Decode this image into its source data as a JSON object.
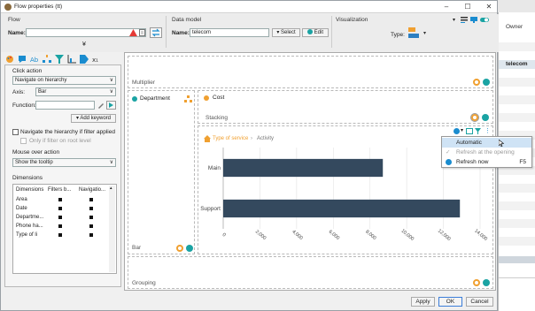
{
  "window": {
    "title": "Flow properties (tt)",
    "minimize": "–",
    "maximize": "☐",
    "close": "✕"
  },
  "background": {
    "owner_label": "Owner",
    "selected_row": "telecom"
  },
  "flow": {
    "section": "Flow",
    "name_label": "Name:",
    "name_value": ""
  },
  "data_model": {
    "section": "Data model",
    "name_label": "Name:",
    "name_value": "telecom",
    "select_label": "Select",
    "edit_label": "Edit"
  },
  "visualization": {
    "section": "Visualization",
    "type_label": "Type:"
  },
  "left_panel": {
    "click_action_label": "Click action",
    "click_action_value": "Navigate on hierarchy",
    "axis_label": "Axis:",
    "axis_value": "Bar",
    "function_label": "Function:",
    "function_value": "",
    "add_keyword_label": "Add keyword",
    "navigate_check_label": "Navigate the hierarchy if filter applied",
    "only_filter_label": "Only if filter on root level",
    "mouseover_label": "Mouse over action",
    "mouseover_value": "Show the tooltip",
    "dimensions_label": "Dimensions",
    "dim_headers": [
      "Dimensions",
      "Filters b...",
      "Navigatio..."
    ],
    "dim_rows": [
      "Area",
      "Date",
      "Departme...",
      "Phone ha...",
      "Type of li"
    ]
  },
  "zones": {
    "multiplier": "Multiplier",
    "department": "Department",
    "cost": "Cost",
    "stacking": "Stacking",
    "bar": "Bar",
    "grouping": "Grouping"
  },
  "breadcrumb": {
    "first": "Type of service",
    "sep": "›",
    "second": "Activity"
  },
  "context_menu": {
    "items": [
      {
        "label": "Automatic",
        "shortcut": ""
      },
      {
        "label": "Refresh at the opening",
        "shortcut": ""
      },
      {
        "label": "Refresh now",
        "shortcut": "F5"
      }
    ]
  },
  "chart_data": {
    "type": "bar",
    "orientation": "horizontal",
    "categories": [
      "Main",
      "Support"
    ],
    "values": [
      8700,
      12900
    ],
    "xlim": [
      0,
      14000
    ],
    "xticks": [
      "0",
      "2,000",
      "4,000",
      "6,000",
      "8,000",
      "10,000",
      "12,000",
      "14,000"
    ],
    "bar_color": "#34495e",
    "grid": true
  },
  "footer": {
    "apply": "Apply",
    "ok": "OK",
    "cancel": "Cancel"
  },
  "colors": {
    "accent_orange": "#f0a030",
    "accent_teal": "#1aa3a3",
    "accent_blue": "#2d7fc1",
    "bar": "#34495e"
  }
}
